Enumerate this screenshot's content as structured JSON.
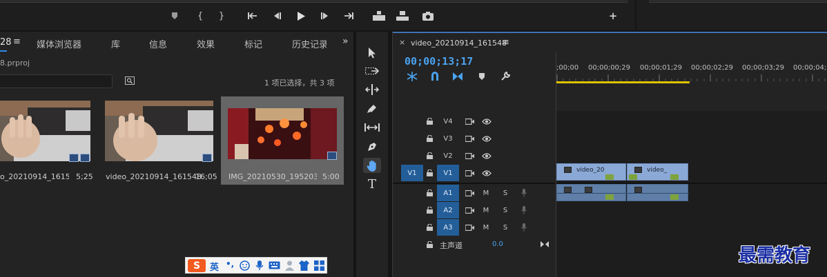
{
  "project_panel": {
    "tabs": [
      {
        "label": "28"
      },
      {
        "label": "媒体浏览器"
      },
      {
        "label": "库"
      },
      {
        "label": "信息"
      },
      {
        "label": "效果"
      },
      {
        "label": "标记"
      },
      {
        "label": "历史记录"
      }
    ],
    "project_file": "8.prproj",
    "selection_status": "1 项已选择，共 3 项",
    "items": [
      {
        "name": "o_20210914_16154...",
        "duration": "5;25"
      },
      {
        "name": "video_20210914_161548",
        "duration": "16;05"
      },
      {
        "name": "IMG_20210530_195203...",
        "duration": "5:00"
      }
    ]
  },
  "timeline": {
    "sequence_name": "video_20210914_161548",
    "timecode": "00;00;13;17",
    "ruler_labels": [
      ";00;00",
      "00;00;00;29",
      "00;00;01;29",
      "00;00;02;29",
      "00;00;03;29",
      "00;00;04;2"
    ],
    "video_tracks": [
      {
        "name": "V4"
      },
      {
        "name": "V3"
      },
      {
        "name": "V2"
      },
      {
        "name": "V1",
        "source": "V1"
      }
    ],
    "audio_tracks": [
      {
        "name": "A1",
        "m": "M",
        "s": "S"
      },
      {
        "name": "A2",
        "m": "M",
        "s": "S"
      },
      {
        "name": "A3",
        "m": "M",
        "s": "S"
      }
    ],
    "master_label": "主声道",
    "master_value": "0.0",
    "clips": [
      {
        "label": "video_20"
      },
      {
        "label": "video_"
      }
    ]
  },
  "ime_toolbar": {
    "lang": "英",
    "punct": "•,"
  },
  "watermark": "最需教育",
  "colors": {
    "accent": "#2d8ceb",
    "timecode": "#4aa3f0",
    "selected_track": "#235e99",
    "video_clip": "#8aa9d6",
    "audio_clip": "#5f7fa8"
  }
}
